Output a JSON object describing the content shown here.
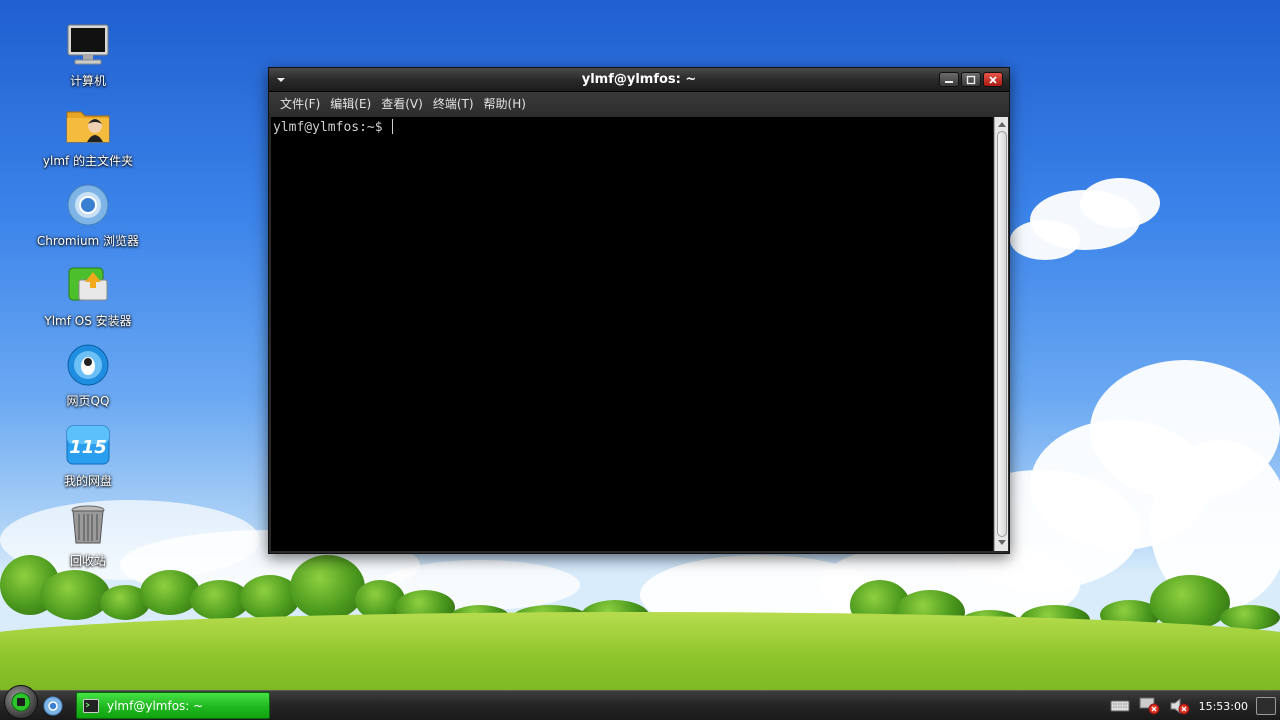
{
  "desktop": {
    "icons": [
      {
        "label": "计算机",
        "icon": "computer-icon"
      },
      {
        "label": "ylmf 的主文件夹",
        "icon": "home-folder-icon"
      },
      {
        "label": "Chromium 浏览器",
        "icon": "chromium-icon"
      },
      {
        "label": "Ylmf OS 安装器",
        "icon": "installer-icon"
      },
      {
        "label": "网页QQ",
        "icon": "qq-icon"
      },
      {
        "label": "我的网盘",
        "icon": "netdisk-115-icon"
      },
      {
        "label": "回收站",
        "icon": "trash-icon"
      }
    ],
    "netdisk_badge": "115"
  },
  "window": {
    "title": "ylmf@ylmfos: ~",
    "menu": [
      "文件(F)",
      "编辑(E)",
      "查看(V)",
      "终端(T)",
      "帮助(H)"
    ],
    "prompt": "ylmf@ylmfos:~$ "
  },
  "taskbar": {
    "task_label": "ylmf@ylmfos: ~",
    "clock": "15:53:00",
    "tray_icons": [
      "keyboard-icon",
      "network-icon",
      "volume-icon"
    ]
  },
  "colors": {
    "task_active": "#1fb81f",
    "terminal_bg": "#000000",
    "close_button": "#c72b20"
  }
}
